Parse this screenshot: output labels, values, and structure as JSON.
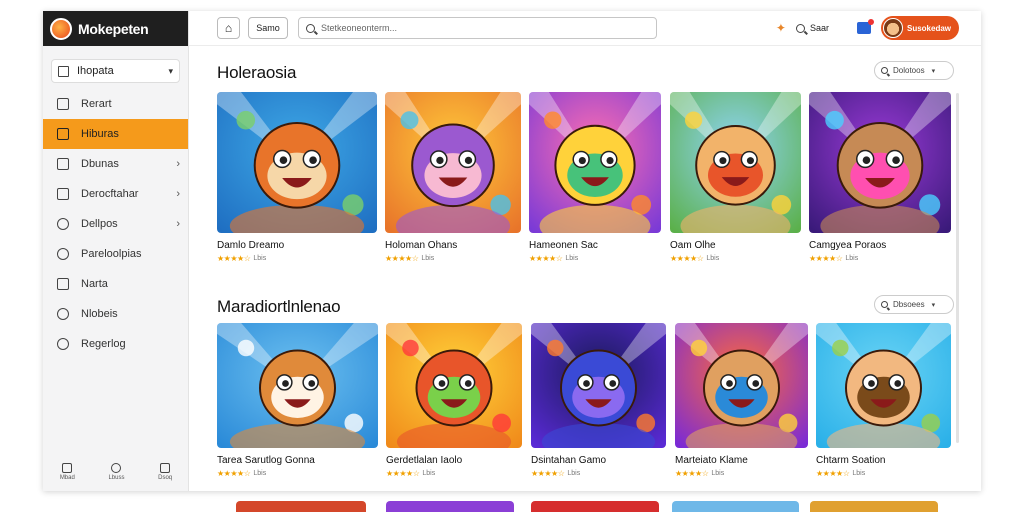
{
  "app": {
    "name": "Mokepeten"
  },
  "sidebar": {
    "select_label": "Ihopata",
    "items": [
      {
        "label": "Rerart",
        "icon": "calendar-icon",
        "arrow": false,
        "active": false
      },
      {
        "label": "Hiburas",
        "icon": "grid-icon",
        "arrow": false,
        "active": true
      },
      {
        "label": "Dbunas",
        "icon": "document-icon",
        "arrow": true,
        "active": false
      },
      {
        "label": "Derocftahar",
        "icon": "folder-icon",
        "arrow": true,
        "active": false
      },
      {
        "label": "Dellpos",
        "icon": "clock-icon",
        "arrow": true,
        "active": false
      },
      {
        "label": "Pareloolpias",
        "icon": "link-icon",
        "arrow": false,
        "active": false
      },
      {
        "label": "Narta",
        "icon": "chart-icon",
        "arrow": false,
        "active": false
      },
      {
        "label": "Nlobeis",
        "icon": "globe-icon",
        "arrow": false,
        "active": false
      },
      {
        "label": "Regerlog",
        "icon": "gear-icon",
        "arrow": false,
        "active": false
      }
    ],
    "bottom": [
      {
        "label": "Mbad",
        "icon": "home-icon"
      },
      {
        "label": "Lbuss",
        "icon": "stopwatch-icon"
      },
      {
        "label": "Dsoq",
        "icon": "chat-icon"
      }
    ]
  },
  "topbar": {
    "small_button": "Samo",
    "search_placeholder": "Stetkeoneonterm...",
    "search_short": "Saar",
    "user_label": "Susokedaw"
  },
  "sections": [
    {
      "title": "Holeraosia",
      "filter": "Dolotoos",
      "cards": [
        {
          "title": "Damlo Dreamo",
          "rating": "4.5",
          "count": "Lbis",
          "art": "fox"
        },
        {
          "title": "Holoman Ohans",
          "rating": "4.0",
          "count": "Lbis",
          "art": "party"
        },
        {
          "title": "Hameonen Sac",
          "rating": "4.0",
          "count": "Lbis",
          "art": "om"
        },
        {
          "title": "Oam Olhe",
          "rating": "4.0",
          "count": "Lbis",
          "art": "boy"
        },
        {
          "title": "Camgyea Poraos",
          "rating": "4.0",
          "count": "Lbis",
          "art": "purple"
        }
      ]
    },
    {
      "title": "Maradiortlnlenao",
      "filter": "Dbsoees",
      "cards": [
        {
          "title": "Tarea Sarutlog Gonna",
          "rating": "4.0",
          "count": "Lbis",
          "art": "dog"
        },
        {
          "title": "Gerdetlalan Iaolo",
          "rating": "4.0",
          "count": "Lbis",
          "art": "slame"
        },
        {
          "title": "Dsintahan Gamo",
          "rating": "4.0",
          "count": "Lbis",
          "art": "cat"
        },
        {
          "title": "Marteiato Klame",
          "rating": "4.0",
          "count": "Lbis",
          "art": "music"
        },
        {
          "title": "Chtarm Soation",
          "rating": "4.0",
          "count": "Lbis",
          "art": "kid"
        }
      ]
    }
  ],
  "colors": {
    "accent": "#f59a1b",
    "brand_bar": "#1f1f1f",
    "user_pill": "#e5521b",
    "stars": "#f0a000"
  }
}
